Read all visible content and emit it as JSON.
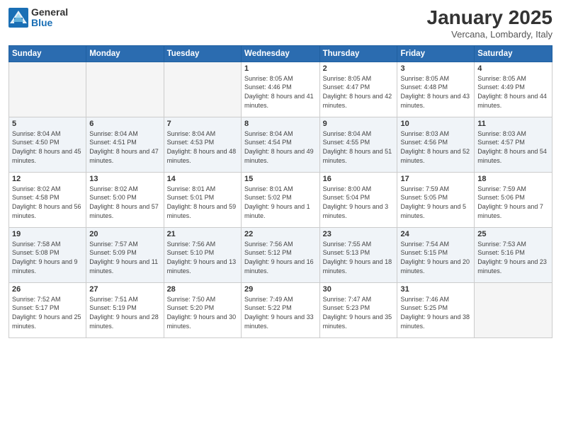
{
  "logo": {
    "general": "General",
    "blue": "Blue"
  },
  "title": "January 2025",
  "location": "Vercana, Lombardy, Italy",
  "weekdays": [
    "Sunday",
    "Monday",
    "Tuesday",
    "Wednesday",
    "Thursday",
    "Friday",
    "Saturday"
  ],
  "weeks": [
    [
      {
        "day": "",
        "sunrise": "",
        "sunset": "",
        "daylight": ""
      },
      {
        "day": "",
        "sunrise": "",
        "sunset": "",
        "daylight": ""
      },
      {
        "day": "",
        "sunrise": "",
        "sunset": "",
        "daylight": ""
      },
      {
        "day": "1",
        "sunrise": "Sunrise: 8:05 AM",
        "sunset": "Sunset: 4:46 PM",
        "daylight": "Daylight: 8 hours and 41 minutes."
      },
      {
        "day": "2",
        "sunrise": "Sunrise: 8:05 AM",
        "sunset": "Sunset: 4:47 PM",
        "daylight": "Daylight: 8 hours and 42 minutes."
      },
      {
        "day": "3",
        "sunrise": "Sunrise: 8:05 AM",
        "sunset": "Sunset: 4:48 PM",
        "daylight": "Daylight: 8 hours and 43 minutes."
      },
      {
        "day": "4",
        "sunrise": "Sunrise: 8:05 AM",
        "sunset": "Sunset: 4:49 PM",
        "daylight": "Daylight: 8 hours and 44 minutes."
      }
    ],
    [
      {
        "day": "5",
        "sunrise": "Sunrise: 8:04 AM",
        "sunset": "Sunset: 4:50 PM",
        "daylight": "Daylight: 8 hours and 45 minutes."
      },
      {
        "day": "6",
        "sunrise": "Sunrise: 8:04 AM",
        "sunset": "Sunset: 4:51 PM",
        "daylight": "Daylight: 8 hours and 47 minutes."
      },
      {
        "day": "7",
        "sunrise": "Sunrise: 8:04 AM",
        "sunset": "Sunset: 4:53 PM",
        "daylight": "Daylight: 8 hours and 48 minutes."
      },
      {
        "day": "8",
        "sunrise": "Sunrise: 8:04 AM",
        "sunset": "Sunset: 4:54 PM",
        "daylight": "Daylight: 8 hours and 49 minutes."
      },
      {
        "day": "9",
        "sunrise": "Sunrise: 8:04 AM",
        "sunset": "Sunset: 4:55 PM",
        "daylight": "Daylight: 8 hours and 51 minutes."
      },
      {
        "day": "10",
        "sunrise": "Sunrise: 8:03 AM",
        "sunset": "Sunset: 4:56 PM",
        "daylight": "Daylight: 8 hours and 52 minutes."
      },
      {
        "day": "11",
        "sunrise": "Sunrise: 8:03 AM",
        "sunset": "Sunset: 4:57 PM",
        "daylight": "Daylight: 8 hours and 54 minutes."
      }
    ],
    [
      {
        "day": "12",
        "sunrise": "Sunrise: 8:02 AM",
        "sunset": "Sunset: 4:58 PM",
        "daylight": "Daylight: 8 hours and 56 minutes."
      },
      {
        "day": "13",
        "sunrise": "Sunrise: 8:02 AM",
        "sunset": "Sunset: 5:00 PM",
        "daylight": "Daylight: 8 hours and 57 minutes."
      },
      {
        "day": "14",
        "sunrise": "Sunrise: 8:01 AM",
        "sunset": "Sunset: 5:01 PM",
        "daylight": "Daylight: 8 hours and 59 minutes."
      },
      {
        "day": "15",
        "sunrise": "Sunrise: 8:01 AM",
        "sunset": "Sunset: 5:02 PM",
        "daylight": "Daylight: 9 hours and 1 minute."
      },
      {
        "day": "16",
        "sunrise": "Sunrise: 8:00 AM",
        "sunset": "Sunset: 5:04 PM",
        "daylight": "Daylight: 9 hours and 3 minutes."
      },
      {
        "day": "17",
        "sunrise": "Sunrise: 7:59 AM",
        "sunset": "Sunset: 5:05 PM",
        "daylight": "Daylight: 9 hours and 5 minutes."
      },
      {
        "day": "18",
        "sunrise": "Sunrise: 7:59 AM",
        "sunset": "Sunset: 5:06 PM",
        "daylight": "Daylight: 9 hours and 7 minutes."
      }
    ],
    [
      {
        "day": "19",
        "sunrise": "Sunrise: 7:58 AM",
        "sunset": "Sunset: 5:08 PM",
        "daylight": "Daylight: 9 hours and 9 minutes."
      },
      {
        "day": "20",
        "sunrise": "Sunrise: 7:57 AM",
        "sunset": "Sunset: 5:09 PM",
        "daylight": "Daylight: 9 hours and 11 minutes."
      },
      {
        "day": "21",
        "sunrise": "Sunrise: 7:56 AM",
        "sunset": "Sunset: 5:10 PM",
        "daylight": "Daylight: 9 hours and 13 minutes."
      },
      {
        "day": "22",
        "sunrise": "Sunrise: 7:56 AM",
        "sunset": "Sunset: 5:12 PM",
        "daylight": "Daylight: 9 hours and 16 minutes."
      },
      {
        "day": "23",
        "sunrise": "Sunrise: 7:55 AM",
        "sunset": "Sunset: 5:13 PM",
        "daylight": "Daylight: 9 hours and 18 minutes."
      },
      {
        "day": "24",
        "sunrise": "Sunrise: 7:54 AM",
        "sunset": "Sunset: 5:15 PM",
        "daylight": "Daylight: 9 hours and 20 minutes."
      },
      {
        "day": "25",
        "sunrise": "Sunrise: 7:53 AM",
        "sunset": "Sunset: 5:16 PM",
        "daylight": "Daylight: 9 hours and 23 minutes."
      }
    ],
    [
      {
        "day": "26",
        "sunrise": "Sunrise: 7:52 AM",
        "sunset": "Sunset: 5:17 PM",
        "daylight": "Daylight: 9 hours and 25 minutes."
      },
      {
        "day": "27",
        "sunrise": "Sunrise: 7:51 AM",
        "sunset": "Sunset: 5:19 PM",
        "daylight": "Daylight: 9 hours and 28 minutes."
      },
      {
        "day": "28",
        "sunrise": "Sunrise: 7:50 AM",
        "sunset": "Sunset: 5:20 PM",
        "daylight": "Daylight: 9 hours and 30 minutes."
      },
      {
        "day": "29",
        "sunrise": "Sunrise: 7:49 AM",
        "sunset": "Sunset: 5:22 PM",
        "daylight": "Daylight: 9 hours and 33 minutes."
      },
      {
        "day": "30",
        "sunrise": "Sunrise: 7:47 AM",
        "sunset": "Sunset: 5:23 PM",
        "daylight": "Daylight: 9 hours and 35 minutes."
      },
      {
        "day": "31",
        "sunrise": "Sunrise: 7:46 AM",
        "sunset": "Sunset: 5:25 PM",
        "daylight": "Daylight: 9 hours and 38 minutes."
      },
      {
        "day": "",
        "sunrise": "",
        "sunset": "",
        "daylight": ""
      }
    ]
  ]
}
